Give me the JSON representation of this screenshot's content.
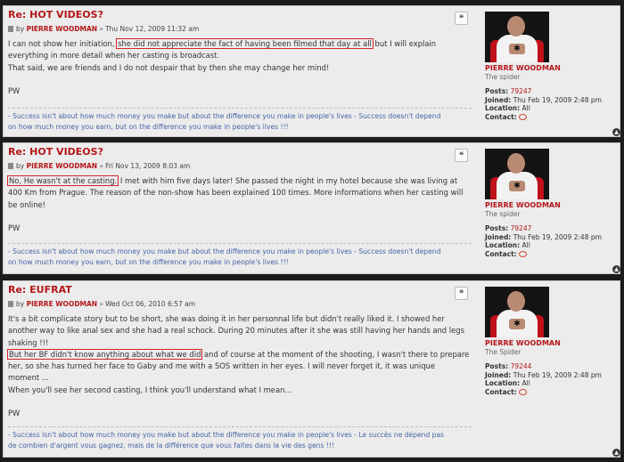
{
  "posts": [
    {
      "title": "Re: HOT VIDEOS?",
      "by": "by",
      "author": "PIERRE WOODMAN",
      "date": "Thu Nov 12, 2009 11:32 am",
      "body_lines": [
        [
          "I can not show her initiation, ",
          "she did not appreciate the fact of having been filmed that day at all",
          " but I will explain"
        ],
        [
          "everything in more detail when her casting is broadcast."
        ],
        [
          "That said, we are friends and I do not despair that by then she may change her mind!"
        ],
        [
          ""
        ],
        [
          "PW"
        ]
      ],
      "signature_lines": [
        "- Success isn't about how much money you make but about the difference you make in people's lives - Success doesn't depend",
        "on how much money you earn, but on the difference you make in people's lives !!!"
      ],
      "profile": {
        "name": "PIERRE WOODMAN",
        "rank": "The spider",
        "posts_label": "Posts:",
        "posts": "79247",
        "joined_label": "Joined:",
        "joined": "Thu Feb 19, 2009 2:48 pm",
        "location_label": "Location:",
        "location": "All",
        "contact_label": "Contact:"
      }
    },
    {
      "title": "Re: HOT VIDEOS?",
      "by": "by",
      "author": "PIERRE WOODMAN",
      "date": "Fri Nov 13, 2009 8:03 am",
      "body_lines": [
        [
          "",
          "No, He wasn't at the casting.",
          " I met with him five days later! She passed the night in my hotel because she was living at"
        ],
        [
          "400 Km from Prague. The reason of the non-show has been explained 100 times. More informations when her casting will"
        ],
        [
          "be online!"
        ],
        [
          ""
        ],
        [
          "PW"
        ]
      ],
      "signature_lines": [
        "- Success isn't about how much money you make but about the difference you make in people's lives - Success doesn't depend",
        "on how much money you earn, but on the difference you make in people's lives !!!"
      ],
      "profile": {
        "name": "PIERRE WOODMAN",
        "rank": "The spider",
        "posts_label": "Posts:",
        "posts": "79247",
        "joined_label": "Joined:",
        "joined": "Thu Feb 19, 2009 2:48 pm",
        "location_label": "Location:",
        "location": "All",
        "contact_label": "Contact:"
      }
    },
    {
      "title": "Re: EUFRAT",
      "by": "by",
      "author": "PIERRE WOODMAN",
      "date": "Wed Oct 06, 2010 6:57 am",
      "body_lines": [
        [
          "It's a bit complicate story but to be short, she was doing it in her personnal life but didn't really liked it. I showed her"
        ],
        [
          "another way to like anal sex and she had a real schock. During 20 minutes after it she was still having her hands and legs"
        ],
        [
          "shaking !!!"
        ],
        [
          "",
          "But her BF didn't know anything about what we did",
          " and of course at the moment of the shooting, I wasn't there to prepare"
        ],
        [
          "her, so she has turned her face to Gaby and me with a SOS written in her eyes. I will never forget it, it was unique"
        ],
        [
          "moment ..."
        ],
        [
          "When you'll see her second casting, I think you'll understand what I mean..."
        ],
        [
          ""
        ],
        [
          "PW"
        ]
      ],
      "signature_lines": [
        "- Success isn't about how much money you make but about the difference you make in people's lives - Le succès ne dépend pas",
        "de combien d'argent vous gagnez, mais de la différence que vous faites dans la vie des gens !!!"
      ],
      "profile": {
        "name": "PIERRE WOODMAN",
        "rank": "The Spider",
        "posts_label": "Posts:",
        "posts": "79244",
        "joined_label": "Joined:",
        "joined": "Thu Feb 19, 2009 2:48 pm",
        "location_label": "Location:",
        "location": "All",
        "contact_label": "Contact:"
      }
    }
  ],
  "icons": {
    "quote": "quote-icon",
    "back_to_top": "back-to-top-icon",
    "contact": "contact-icon",
    "post": "post-icon"
  },
  "colors": {
    "accent": "#b3171a",
    "signature": "#4664a6",
    "highlight_box": "#d2252a"
  }
}
